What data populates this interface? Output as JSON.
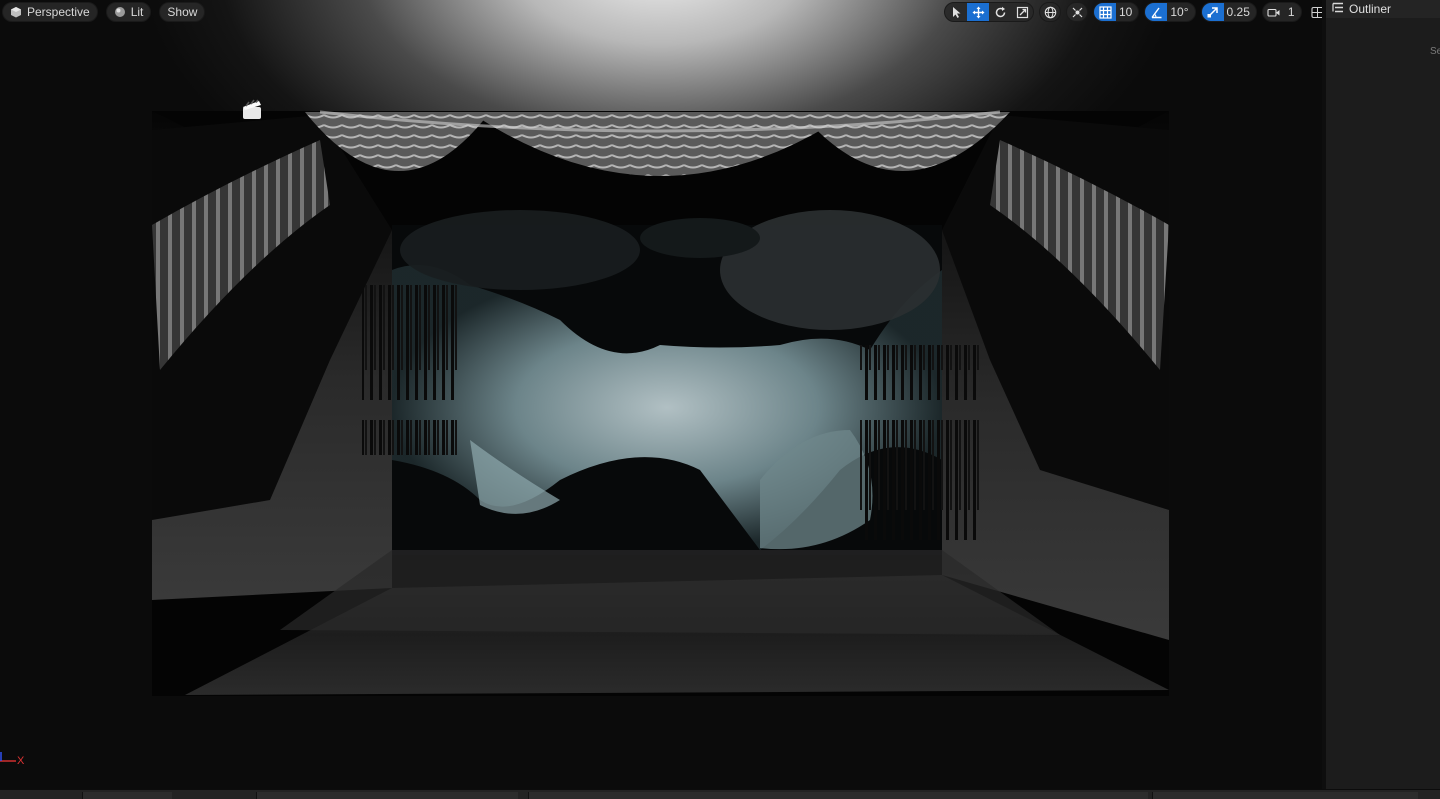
{
  "viewport": {
    "view_mode": "Perspective",
    "lighting_mode": "Lit",
    "show_label": "Show",
    "grid_snap": "10",
    "rotation_snap": "10°",
    "scale_snap": "0.25",
    "camera_speed": "1",
    "axis_label": "X",
    "icons": {
      "view_mode": "perspective-cube-icon",
      "lighting": "lit-sphere-icon",
      "select": "select-arrow-icon",
      "translate": "translate-icon",
      "rotate": "rotate-icon",
      "scale": "scale-icon",
      "world": "world-globe-icon",
      "surface_snap": "surface-snap-icon",
      "grid": "grid-snap-icon",
      "angle": "rotation-snap-icon",
      "scale_snap": "scale-snap-icon",
      "camera": "camera-speed-icon",
      "layout": "viewport-layout-icon",
      "sequencer": "sequencer-clapper-icon"
    },
    "colors": {
      "accent": "#1b6fd1",
      "axis_x": "#d33333"
    }
  },
  "outliner": {
    "title": "Outliner",
    "search_hint": "Se"
  }
}
